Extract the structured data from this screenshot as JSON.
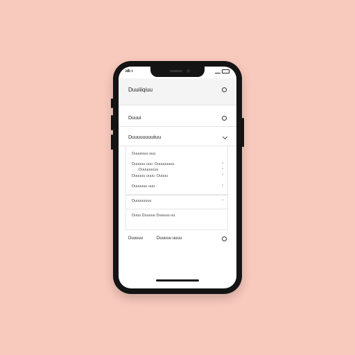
{
  "status": {
    "time": "ıdı ı"
  },
  "header": {
    "title": "Duuiiiqiuu"
  },
  "account": {
    "label": "Duuui"
  },
  "section": {
    "title": "Duuuuuuuuiiuu",
    "subtitle": "Duuuiuuu uuu",
    "items": [
      {
        "a": "Duuuuu uuu",
        "b": "Duuuuuuuu"
      },
      {
        "a": "Duuuuuuuu",
        "b": ""
      },
      {
        "a": "Duuuuu uuuu",
        "b": "Duuuu"
      }
    ],
    "extra": "Duuuuuu uuu"
  },
  "card2": {
    "title": "Duuuuuuuu",
    "text": "Duuu Duuuuu Duuuuu uu"
  },
  "footer": {
    "left": "Duuuuu",
    "right": "Duuuuu uuuu"
  }
}
